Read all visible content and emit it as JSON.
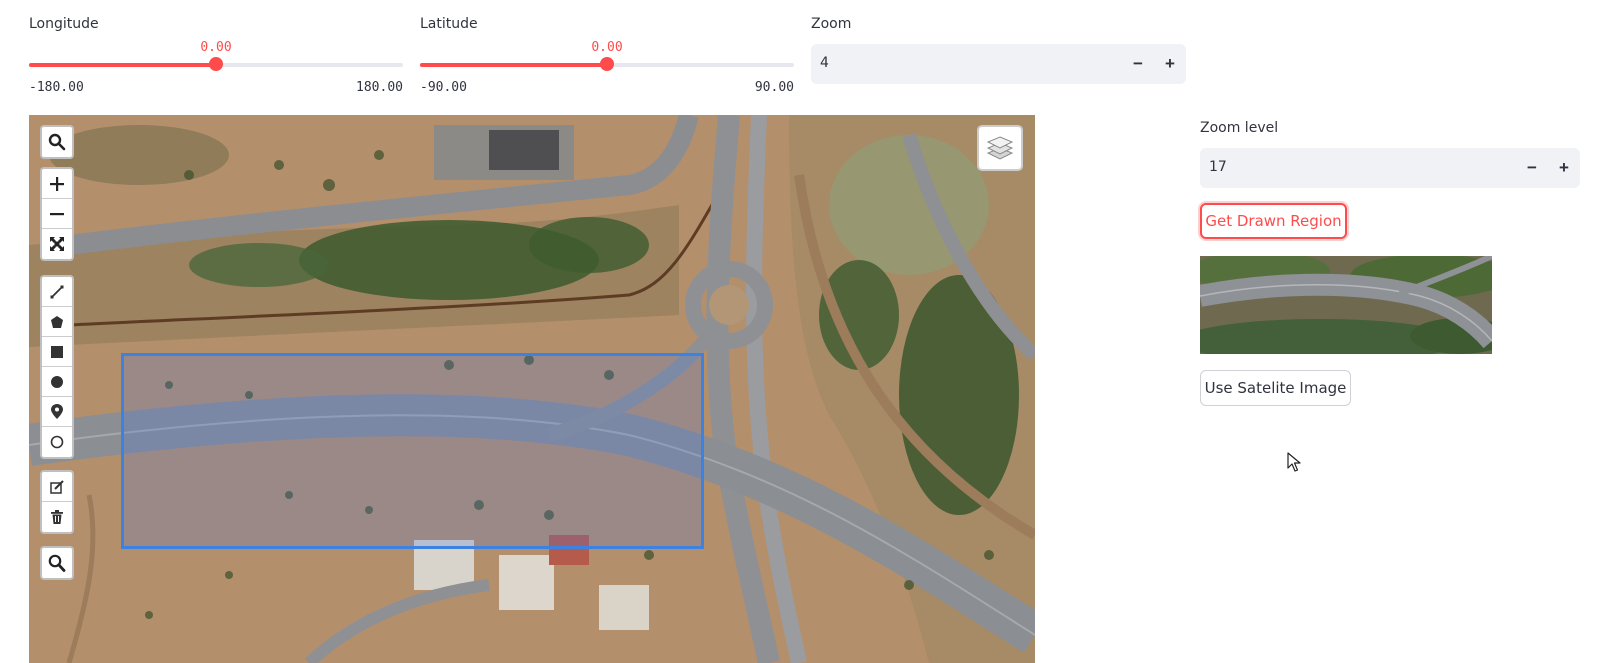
{
  "longitude": {
    "label": "Longitude",
    "value": "0.00",
    "min": "-180.00",
    "max": "180.00",
    "fraction": 0.5
  },
  "latitude": {
    "label": "Latitude",
    "value": "0.00",
    "min": "-90.00",
    "max": "90.00",
    "fraction": 0.5
  },
  "zoom": {
    "label": "Zoom",
    "value": "4",
    "minus": "−",
    "plus": "+"
  },
  "zoom_level": {
    "label": "Zoom level",
    "value": "17",
    "minus": "−",
    "plus": "+"
  },
  "buttons": {
    "get_drawn_region": "Get Drawn Region",
    "use_satellite": "Use Satelite Image"
  },
  "map": {
    "tools": [
      "search-icon",
      "zoom-in-icon",
      "zoom-out-icon",
      "fullscreen-icon",
      "polyline-icon",
      "polygon-icon",
      "rectangle-icon",
      "circle-icon",
      "marker-icon",
      "circle-marker-icon",
      "edit-icon",
      "trash-icon",
      "geocoder-search-icon"
    ],
    "layers_icon": "layers-icon"
  },
  "colors": {
    "accent": "#ff4b4b",
    "track": "#e6e8ee",
    "input_bg": "#f0f2f6",
    "drawn_region": "#3d82e0",
    "text": "#31333f"
  }
}
